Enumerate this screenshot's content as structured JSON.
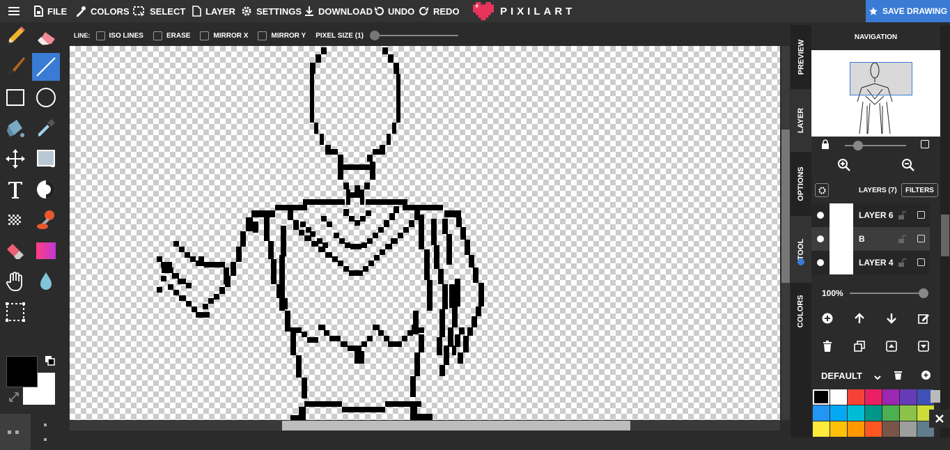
{
  "menu": {
    "file": "FILE",
    "colors": "COLORS",
    "select": "SELECT",
    "layer": "LAYER",
    "settings": "SETTINGS",
    "download": "DOWNLOAD",
    "undo": "UNDO",
    "redo": "REDO"
  },
  "brand": {
    "name": "PIXILART",
    "heart_color": "#e8345a"
  },
  "save_label": "SAVE DRAWING",
  "accent_color": "#3a7bd5",
  "tools": [
    "pencil-icon",
    "eraser-icon",
    "brush-icon",
    "line-icon",
    "rectangle-icon",
    "circle-icon",
    "bucket-icon",
    "eyedropper-icon",
    "move-icon",
    "select-fill-icon",
    "text-icon",
    "lighten-icon",
    "dither-icon",
    "stamp-icon",
    "eraser-pink-icon",
    "gradient-icon",
    "hand-icon",
    "drop-icon",
    "marquee-icon"
  ],
  "active_tool": "line-icon",
  "colors": {
    "primary": "#000000",
    "secondary": "#ffffff"
  },
  "options": {
    "prefix": "LINE:",
    "iso_lines": "ISO LINES",
    "erase": "ERASE",
    "mirror_x": "MIRROR X",
    "mirror_y": "MIRROR Y",
    "pixel_size": "PIXEL SIZE (1)"
  },
  "side_tabs": {
    "preview": "PREVIEW",
    "layer": "LAYER",
    "options": "OPTIONS",
    "tool": "TOOL",
    "colors": "COLORS"
  },
  "navigation": {
    "title": "NAVIGATION"
  },
  "layers": {
    "title": "LAYERS (7)",
    "filters": "FILTERS",
    "items": [
      {
        "name": "LAYER 6",
        "selected": false
      },
      {
        "name": "B",
        "selected": true
      },
      {
        "name": "LAYER 4",
        "selected": false
      }
    ],
    "opacity": "100%"
  },
  "palette": {
    "name": "DEFAULT",
    "swatches": [
      "#000000",
      "#ffffff",
      "#f44336",
      "#e91e63",
      "#9c27b0",
      "#673ab7",
      "#3f51b5",
      "#2196f3",
      "#03a9f4",
      "#00bcd4",
      "#009688",
      "#4caf50",
      "#8bc34a",
      "#cddc39",
      "#ffeb3b",
      "#ffc107",
      "#ff9800",
      "#ff5722",
      "#795548",
      "#9e9e9e",
      "#607d8b"
    ]
  }
}
